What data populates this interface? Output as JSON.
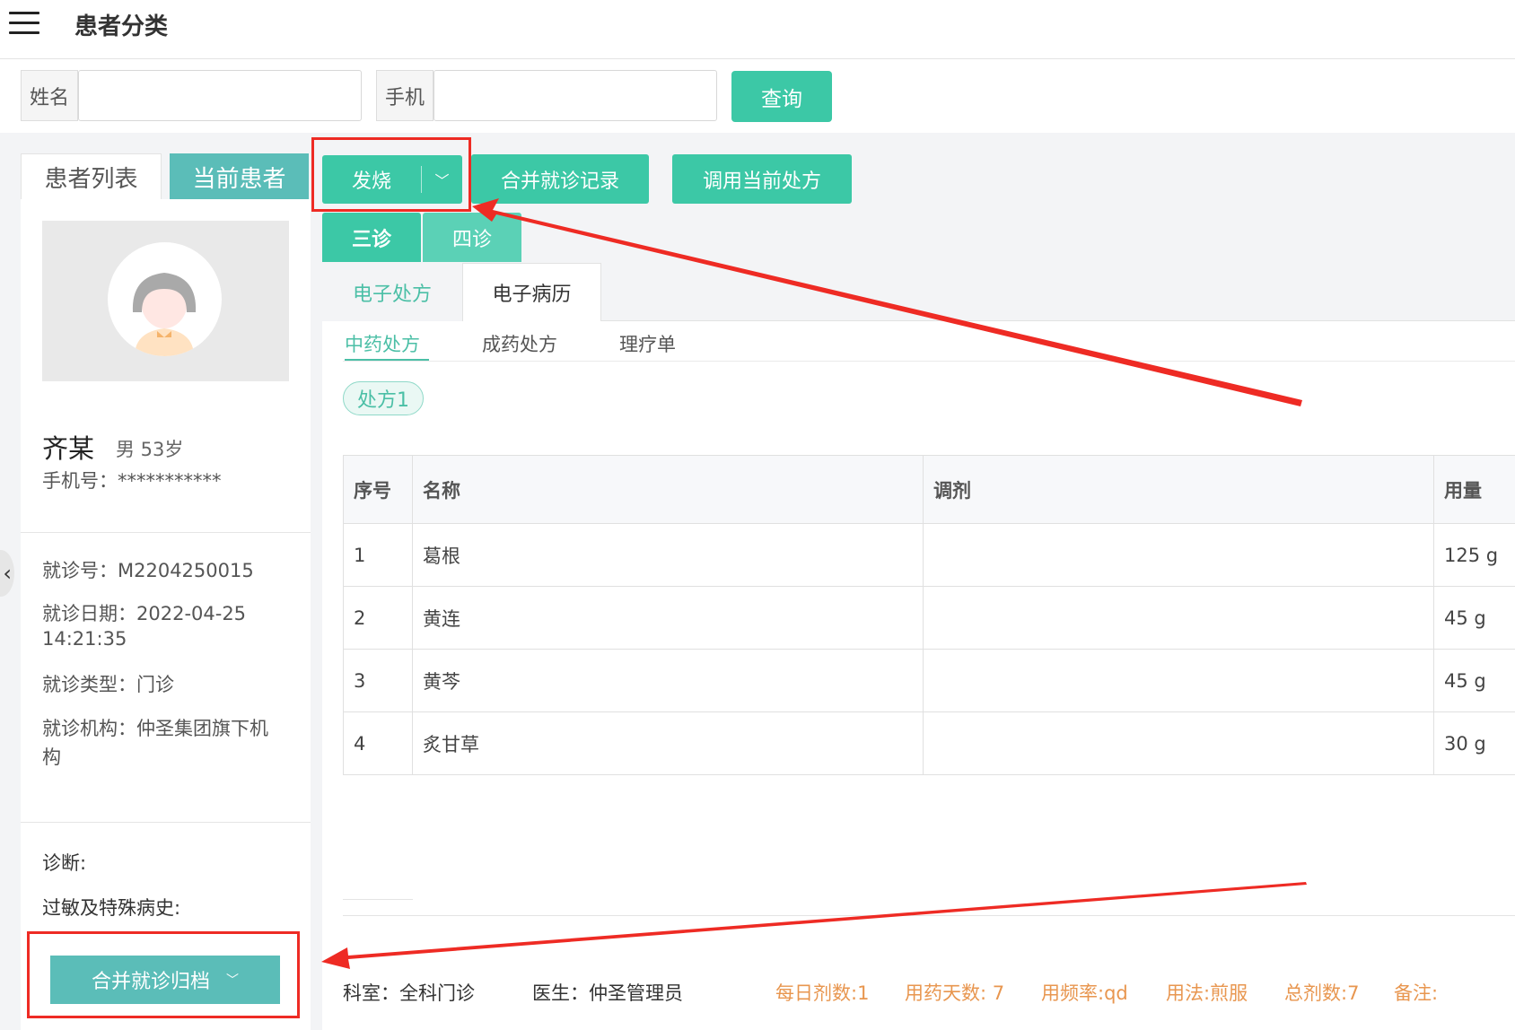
{
  "header": {
    "title": "患者分类"
  },
  "search": {
    "name_label": "姓名",
    "name_value": "",
    "phone_label": "手机",
    "phone_value": "",
    "query_button": "查询"
  },
  "left_tabs": {
    "patient_list": "患者列表",
    "current_patient": "当前患者"
  },
  "patient": {
    "name": "齐某",
    "gender_age": "男 53岁",
    "phone_label": "手机号：",
    "phone_value": "***********",
    "visit_no_label": "就诊号：",
    "visit_no": "M2204250015",
    "visit_date_label": "就诊日期：",
    "visit_date": "2022-04-25",
    "visit_time": "14:21:35",
    "visit_type_label": "就诊类型：",
    "visit_type": "门诊",
    "institution_label": "就诊机构：",
    "institution_line1": "仲圣集团旗下机",
    "institution_line2": "构",
    "diagnosis_label": "诊断:",
    "allergy_label": "过敏及特殊病史:",
    "merge_archive_button": "合并就诊归档"
  },
  "toolbar": {
    "category_button": "发烧",
    "merge_records_button": "合并就诊记录",
    "use_prescription_button": "调用当前处方"
  },
  "visit_tabs": [
    "三诊",
    "四诊"
  ],
  "record_tabs": {
    "e_prescription": "电子处方",
    "e_medical_record": "电子病历"
  },
  "sub_tabs": [
    "中药处方",
    "成药处方",
    "理疗单"
  ],
  "prescription_tag": "处方1",
  "table": {
    "headers": [
      "序号",
      "名称",
      "调剂",
      "用量"
    ],
    "rows": [
      [
        "1",
        "葛根",
        "",
        "125 g"
      ],
      [
        "2",
        "黄连",
        "",
        "45 g"
      ],
      [
        "3",
        "黄芩",
        "",
        "45 g"
      ],
      [
        "4",
        "炙甘草",
        "",
        "30 g"
      ]
    ]
  },
  "footer": {
    "department": "科室：全科门诊",
    "doctor": "医生：仲圣管理员",
    "daily_doses": "每日剂数:1",
    "days": "用药天数: 7",
    "frequency": "用频率:qd",
    "usage": "用法:煎服",
    "total_doses": "总剂数:7",
    "remark": "备注:"
  },
  "colors": {
    "accent": "#3cc8a6",
    "teal_secondary": "#5bbdb8",
    "annotation_red": "#ee2b24",
    "footer_orange": "#e8964f"
  }
}
